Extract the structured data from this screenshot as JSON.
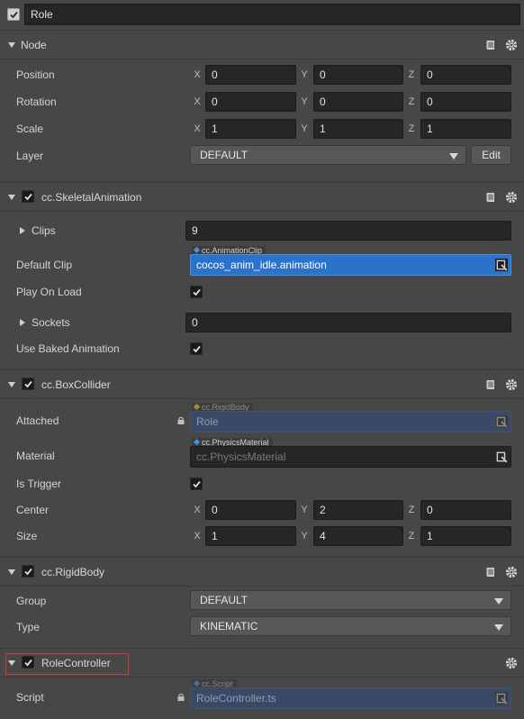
{
  "entity": {
    "name": "Role",
    "enabled": true
  },
  "node": {
    "title": "Node",
    "position": {
      "label": "Position",
      "x": "0",
      "y": "0",
      "z": "0"
    },
    "rotation": {
      "label": "Rotation",
      "x": "0",
      "y": "0",
      "z": "0"
    },
    "scale": {
      "label": "Scale",
      "x": "1",
      "y": "1",
      "z": "1"
    },
    "layer": {
      "label": "Layer",
      "value": "DEFAULT",
      "edit_label": "Edit"
    }
  },
  "axes": {
    "x": "X",
    "y": "Y",
    "z": "Z"
  },
  "skeletal": {
    "title": "cc.SkeletalAnimation",
    "clips": {
      "label": "Clips",
      "value": "9"
    },
    "default_clip": {
      "label": "Default Clip",
      "type_tag": "cc.AnimationClip",
      "value": "cocos_anim_idle.animation"
    },
    "play_on_load": {
      "label": "Play On Load",
      "checked": true
    },
    "sockets": {
      "label": "Sockets",
      "value": "0"
    },
    "use_baked": {
      "label": "Use Baked Animation",
      "checked": true
    }
  },
  "box_collider": {
    "title": "cc.BoxCollider",
    "attached": {
      "label": "Attached",
      "type_tag": "cc.RigidBody",
      "value": "Role"
    },
    "material": {
      "label": "Material",
      "type_tag": "cc.PhysicsMaterial",
      "value": "cc.PhysicsMaterial"
    },
    "is_trigger": {
      "label": "Is Trigger",
      "checked": true
    },
    "center": {
      "label": "Center",
      "x": "0",
      "y": "2",
      "z": "0"
    },
    "size": {
      "label": "Size",
      "x": "1",
      "y": "4",
      "z": "1"
    }
  },
  "rigid_body": {
    "title": "cc.RigidBody",
    "group": {
      "label": "Group",
      "value": "DEFAULT"
    },
    "type": {
      "label": "Type",
      "value": "KINEMATIC"
    }
  },
  "role_controller": {
    "title": "RoleController",
    "script": {
      "label": "Script",
      "type_tag": "cc.Script",
      "value": "RoleController.ts"
    }
  },
  "colors": {
    "panel_bg": "#474747",
    "field_bg": "#262626",
    "selected_asset": "#2a73c9",
    "highlight_box": "#d23a3a"
  }
}
